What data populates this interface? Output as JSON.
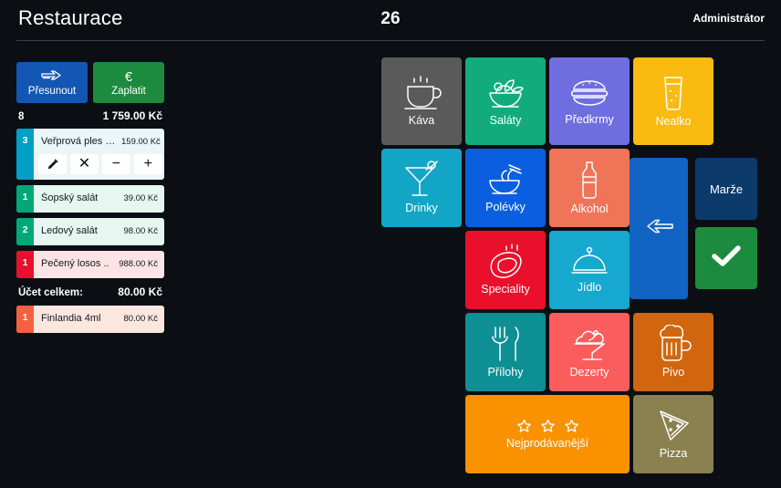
{
  "header": {
    "title": "Restaurace",
    "table_number": "26",
    "user": "Administrátor"
  },
  "order_panel": {
    "move_button": {
      "label": "Přesunout",
      "icon": "double-arrow-right-icon",
      "color": "#1257b4"
    },
    "pay_button": {
      "label": "Zaplatit",
      "icon": "euro-icon",
      "symbol": "€",
      "color": "#1c8b3f"
    },
    "summary": {
      "count": "8",
      "total": "1 759.00 Kč"
    },
    "items": [
      {
        "qty": "3",
        "name": "Veřprová ples s ..",
        "price": "159.00 Kč",
        "accent": "#00a0c6",
        "bg": "#eaf6fa",
        "expanded": true,
        "actions": [
          {
            "name": "edit-item-button",
            "icon": "pencil-icon"
          },
          {
            "name": "delete-item-button",
            "icon": "close-icon",
            "symbol": "✕"
          },
          {
            "name": "decrease-qty-button",
            "icon": "minus-icon",
            "symbol": "−"
          },
          {
            "name": "increase-qty-button",
            "icon": "plus-icon",
            "symbol": "+"
          }
        ]
      },
      {
        "qty": "1",
        "name": "Šopský salát",
        "price": "39.00 Kč",
        "accent": "#00a878",
        "bg": "#e6f6f0",
        "expanded": false
      },
      {
        "qty": "2",
        "name": "Ledový salát",
        "price": "98.00 Kč",
        "accent": "#00a878",
        "bg": "#e6f6f0",
        "expanded": false
      },
      {
        "qty": "1",
        "name": "Pečený losos ..",
        "price": "988.00 Kč",
        "accent": "#e8112d",
        "bg": "#fbe3e6",
        "expanded": false
      }
    ],
    "bill_total": {
      "label": "Účet celkem:",
      "value": "80.00 Kč"
    },
    "extra_items": [
      {
        "qty": "1",
        "name": "Finlandia 4ml",
        "price": "80.00 Kč",
        "accent": "#f4613e",
        "bg": "#fbe6e0",
        "expanded": false
      }
    ]
  },
  "categories": [
    {
      "label": "Káva",
      "icon": "coffee-cup-icon",
      "color": "#5a5a5a"
    },
    {
      "label": "Saláty",
      "icon": "salad-bowl-icon",
      "color": "#11ab7c"
    },
    {
      "label": "Předkrmy",
      "icon": "burger-icon",
      "color": "#6f6ee0"
    },
    {
      "label": "Nealko",
      "icon": "soda-glass-icon",
      "color": "#fabb11"
    },
    {
      "label": "Drinky",
      "icon": "cocktail-icon",
      "color": "#12a5c6"
    },
    {
      "label": "Polévky",
      "icon": "noodle-bowl-icon",
      "color": "#0a5fe0"
    },
    {
      "label": "Alkohol",
      "icon": "bottle-icon",
      "color": "#ef7458"
    },
    {
      "label": "Speciality",
      "icon": "steak-icon",
      "color": "#ea0f2b"
    },
    {
      "label": "Jídlo",
      "icon": "cloche-icon",
      "color": "#17a8cf"
    },
    {
      "label": "Přílohy",
      "icon": "fork-knife-icon",
      "color": "#0e8f94"
    },
    {
      "label": "Dezerty",
      "icon": "ice-cream-icon",
      "color": "#fb5d5d"
    },
    {
      "label": "Pivo",
      "icon": "beer-mug-icon",
      "color": "#d1660f"
    },
    {
      "label": "Nejprodávanější",
      "icon": "three-stars-icon",
      "color": "#fa9200"
    },
    {
      "label": "Pizza",
      "icon": "pizza-slice-icon",
      "color": "#8a8050"
    }
  ],
  "controls": {
    "back": {
      "icon": "arrow-left-icon",
      "color": "#1163c4"
    },
    "margin": {
      "label": "Marže",
      "color": "#0c3a6b"
    },
    "confirm": {
      "icon": "check-icon",
      "color": "#1c8b3f"
    }
  }
}
